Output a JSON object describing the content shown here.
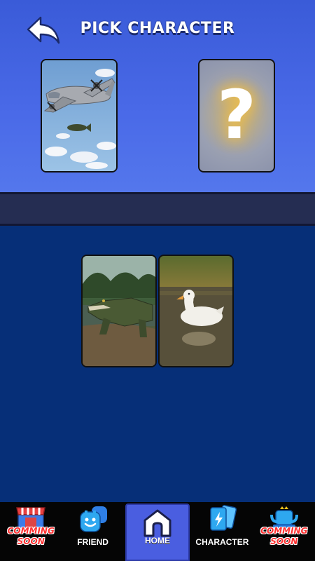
{
  "header": {
    "title": "PICK CHARACTER"
  },
  "slots": {
    "left": {
      "character": "bomber-plane"
    },
    "right": {
      "mark": "?"
    }
  },
  "choices": [
    {
      "character": "crocodile"
    },
    {
      "character": "duck"
    }
  ],
  "nav": {
    "shop": {
      "label": "COMMING SOON",
      "icon": "shop-icon"
    },
    "friend": {
      "label": "FRIEND",
      "icon": "friend-icon"
    },
    "home": {
      "label": "HOME",
      "icon": "home-icon"
    },
    "character": {
      "label": "CHARACTER",
      "icon": "cards-icon"
    },
    "ranking": {
      "label": "COMMING SOON",
      "icon": "trophy-icon"
    }
  },
  "colors": {
    "header_bg": "#3a5bd8",
    "band_bg": "#252d52",
    "lower_bg": "#062f78",
    "nav_bg": "#050505",
    "active_tab": "#4a5ee0",
    "coming_soon": "#ff3030"
  }
}
